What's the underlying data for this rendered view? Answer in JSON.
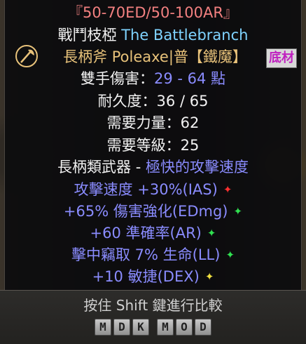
{
  "item": {
    "affix_title": "『50-70ED/50-100AR』",
    "unique_name_zh": "戰鬥枝椏",
    "unique_name_en": "The Battlebranch",
    "base_line": "長柄斧 Poleaxe|普【鐵魔】",
    "badge": "底材",
    "damage_label": "雙手傷害：",
    "damage_value": "29 - 64 點",
    "durability": "耐久度：36 / 65",
    "req_str": "需要力量：62",
    "req_level": "需要等級：25",
    "weapon_class": "長柄類武器 - ",
    "attack_speed_class": "極快的攻擊速度",
    "mods": [
      {
        "text": "攻擊速度 +30%(IAS)",
        "star": "✦",
        "star_color": "#ff3030"
      },
      {
        "text": "+65% 傷害強化(EDmg)",
        "star": "✦",
        "star_color": "#30e050"
      },
      {
        "text": "+60 準確率(AR)",
        "star": "✦",
        "star_color": "#30e050"
      },
      {
        "text": "擊中竊取 7% 生命(LL)",
        "star": "✦",
        "star_color": "#30e050"
      },
      {
        "text": "+10 敏捷(DEX)",
        "star": "✦",
        "star_color": "#f0e040"
      }
    ]
  },
  "footer": {
    "hint": "按住 Shift 鍵進行比較",
    "keys": [
      "M",
      "D",
      "K",
      "M",
      "O",
      "D"
    ]
  },
  "icons": {
    "axe": "axe-icon"
  }
}
